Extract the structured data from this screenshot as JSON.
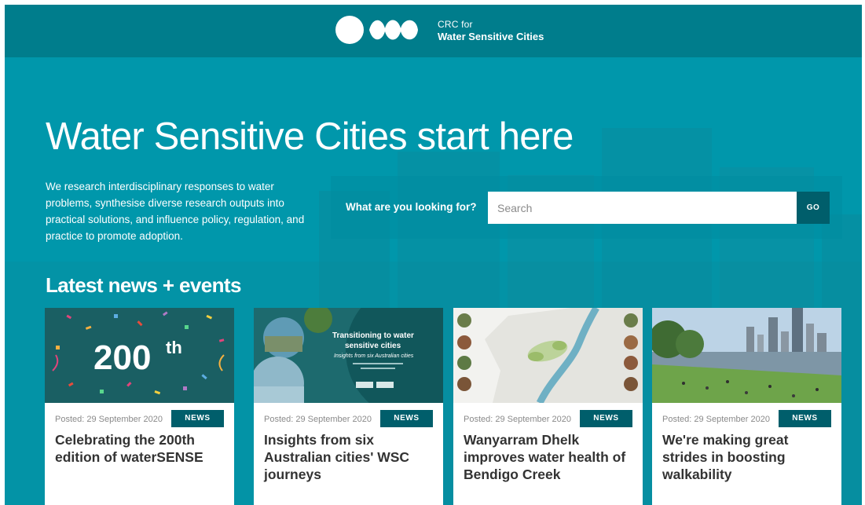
{
  "header": {
    "logo_line1": "CRC for",
    "logo_line2": "Water Sensitive Cities"
  },
  "hero": {
    "title": "Water Sensitive Cities start here",
    "description": "We research interdisciplinary responses to water problems, synthesise diverse research outputs into practical solutions, and influence policy, regulation, and practice to promote adoption."
  },
  "search": {
    "label": "What are you looking for?",
    "placeholder": "Search",
    "value": "",
    "button_label": "GO"
  },
  "news": {
    "section_title": "Latest news + events",
    "cards": [
      {
        "posted": "Posted: 29 September 2020",
        "tag": "NEWS",
        "title": "Celebrating the 200th edition of waterSENSE",
        "image": {
          "number": "200",
          "suffix": "th"
        }
      },
      {
        "posted": "Posted: 29 September 2020",
        "tag": "NEWS",
        "title": "Insights from six Australian cities' WSC journeys",
        "image": {
          "line1": "Transitioning to water",
          "line2": "sensitive cities",
          "line3": "Insights from six Australian cities"
        }
      },
      {
        "posted": "Posted: 29 September 2020",
        "tag": "NEWS",
        "title": "Wanyarram Dhelk improves water health of Bendigo Creek"
      },
      {
        "posted": "Posted: 29 September 2020",
        "tag": "NEWS",
        "title": "We're making great strides in boosting walkability"
      }
    ]
  },
  "colors": {
    "hero_bg": "#0097ab",
    "header_bg": "#007d8c",
    "accent_dark": "#005e6b",
    "tile_bg": "#1a5f63"
  }
}
